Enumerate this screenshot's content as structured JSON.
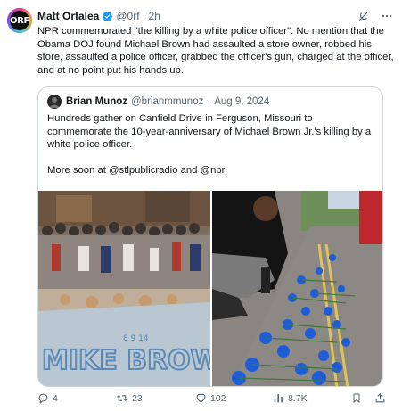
{
  "author": {
    "avatar_text": "ORF",
    "name": "Matt Orfalea",
    "handle": "@0rf",
    "separator": "·",
    "time": "2h"
  },
  "tweet_text": "NPR commemorated \"the killing by a white police officer\". No mention that the Obama DOJ found Michael Brown had assaulted a store owner, robbed his store, assaulted a police officer, grabbed the officer's gun, charged at the officer, and at no point put his hands up.",
  "quote": {
    "name": "Brian Munoz",
    "handle": "@brianmmunoz",
    "separator": "·",
    "date": "Aug 9, 2024",
    "text_1": "Hundreds gather on Canfield Drive in Ferguson, Missouri to commemorate the 10-year-anniversary of Michael Brown Jr.'s killing by a white police officer.",
    "text_2": "More soon at @stlpublicradio and @npr.",
    "image_left_text": "MIKE BROWN",
    "image_left_small_text": "8 9 14"
  },
  "actions": {
    "replies": "4",
    "reposts": "23",
    "likes": "102",
    "views": "8.7K"
  },
  "colors": {
    "accent": "#1d9bf0",
    "text_secondary": "#536471",
    "border": "#cfd9de"
  },
  "icons": [
    "verified-badge-icon",
    "grok-icon",
    "more-icon",
    "reply-icon",
    "repost-icon",
    "like-icon",
    "views-icon",
    "bookmark-icon",
    "share-icon"
  ]
}
